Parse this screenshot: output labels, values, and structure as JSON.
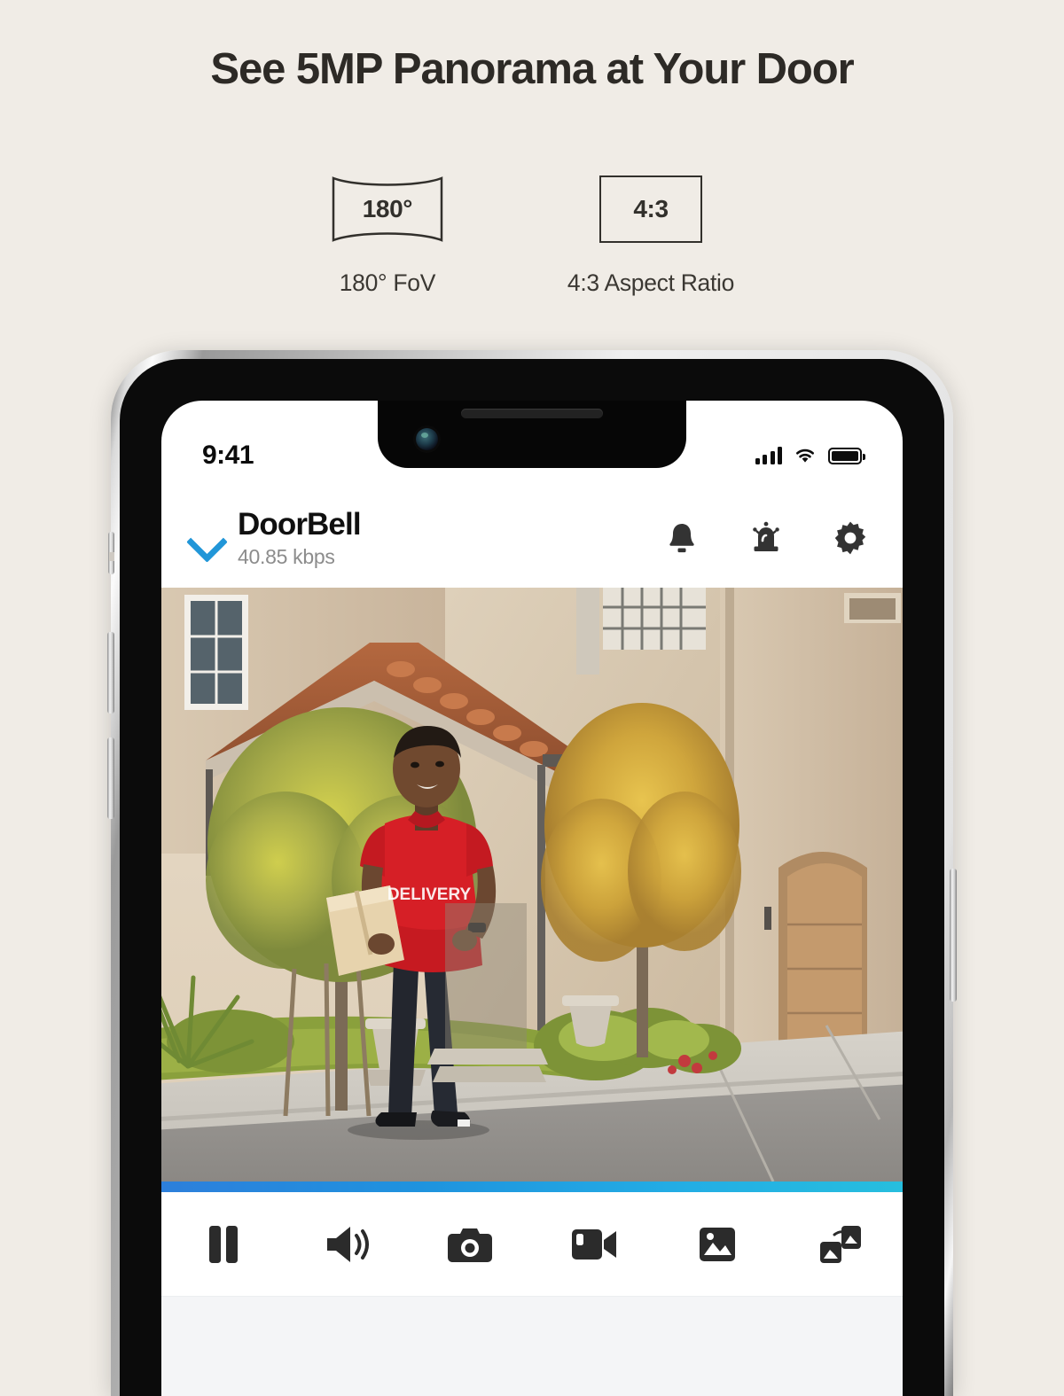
{
  "headline": "See 5MP Panorama at Your Door",
  "features": [
    {
      "badge_value": "180°",
      "label": "180° FoV",
      "shape": "panorama-barrel",
      "icon": "fov-badge-icon"
    },
    {
      "badge_value": "4:3",
      "label": "4:3 Aspect Ratio",
      "shape": "rectangle",
      "icon": "aspect-ratio-badge-icon"
    }
  ],
  "phone": {
    "status_bar": {
      "time": "9:41",
      "signal_icon": "cellular-signal-icon",
      "wifi_icon": "wifi-icon",
      "battery_icon": "battery-icon"
    },
    "app_header": {
      "collapse_icon": "chevron-down-icon",
      "title": "DoorBell",
      "subtitle": "40.85 kbps",
      "actions": [
        {
          "name": "bell-icon",
          "label": "Bell"
        },
        {
          "name": "siren-icon",
          "label": "Siren"
        },
        {
          "name": "gear-icon",
          "label": "Settings"
        }
      ]
    },
    "video": {
      "scene": "Delivery person in red shirt carrying a package walking on driveway in front of a beige stucco house with terracotta tile roof"
    },
    "progress": {
      "color_start": "#2d7fdb",
      "color_end": "#27bede",
      "percent": 100
    },
    "toolbar": [
      {
        "name": "pause-button",
        "label": "Pause"
      },
      {
        "name": "speaker-button",
        "label": "Speaker"
      },
      {
        "name": "snapshot-button",
        "label": "Snapshot"
      },
      {
        "name": "record-video-button",
        "label": "Record"
      },
      {
        "name": "gallery-button",
        "label": "Gallery"
      },
      {
        "name": "multi-view-button",
        "label": "Multi View"
      }
    ]
  },
  "colors": {
    "page_background": "#f0ece6",
    "headline": "#2d2a26",
    "accent_blue": "#2196d8",
    "progress_start": "#2d7fdb",
    "progress_end": "#27bede"
  }
}
